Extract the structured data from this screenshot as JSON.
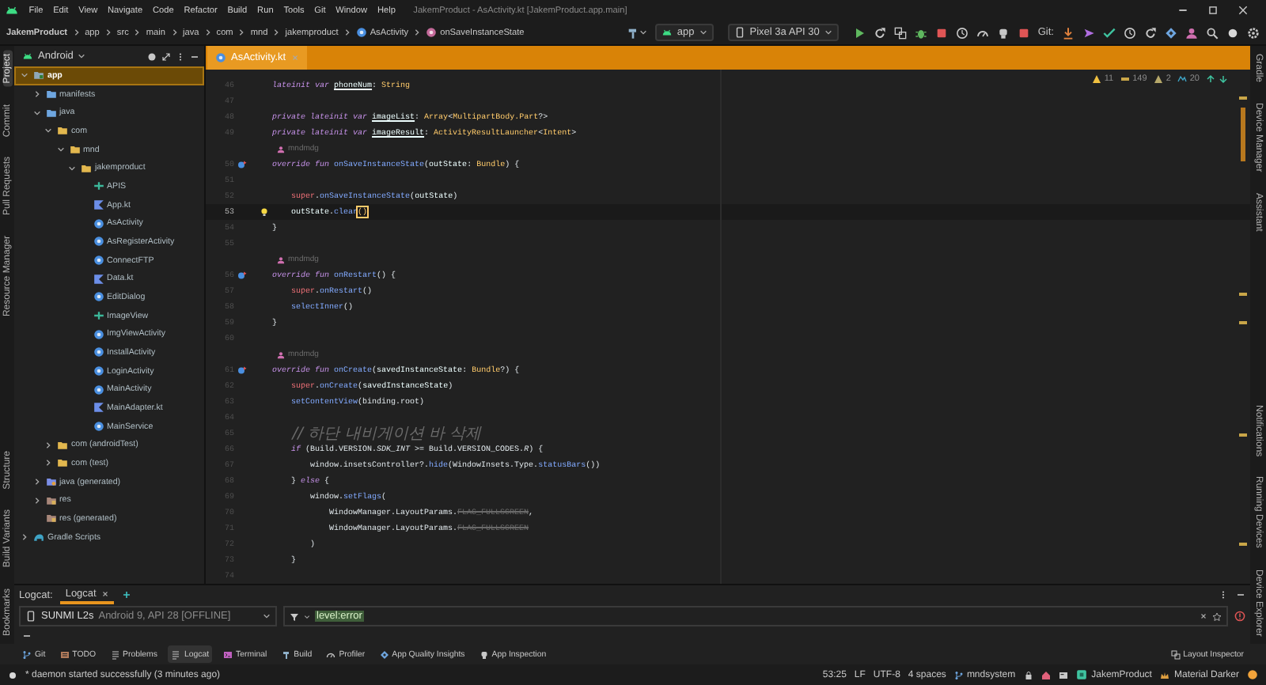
{
  "window": {
    "title": "JakemProduct - AsActivity.kt [JakemProduct.app.main]",
    "menu": [
      "File",
      "Edit",
      "View",
      "Navigate",
      "Code",
      "Refactor",
      "Build",
      "Run",
      "Tools",
      "Git",
      "Window",
      "Help"
    ]
  },
  "breadcrumbs": [
    {
      "label": "JakemProduct",
      "kind": "project"
    },
    {
      "label": "app",
      "kind": "folder"
    },
    {
      "label": "src",
      "kind": "folder"
    },
    {
      "label": "main",
      "kind": "folder"
    },
    {
      "label": "java",
      "kind": "folder"
    },
    {
      "label": "com",
      "kind": "folder"
    },
    {
      "label": "mnd",
      "kind": "folder"
    },
    {
      "label": "jakemproduct",
      "kind": "folder"
    },
    {
      "label": "AsActivity",
      "kind": "class"
    },
    {
      "label": "onSaveInstanceState",
      "kind": "method"
    }
  ],
  "run_toolbar": {
    "configuration": "app",
    "device": "Pixel 3a API 30",
    "git_label": "Git:"
  },
  "left_stripe": {
    "top": [
      {
        "label": "Project",
        "selected": true
      },
      {
        "label": "Commit",
        "selected": false
      },
      {
        "label": "Pull Requests",
        "selected": false
      },
      {
        "label": "Resource Manager",
        "selected": false
      }
    ],
    "bottom": [
      {
        "label": "Structure",
        "selected": false
      },
      {
        "label": "Build Variants",
        "selected": false
      },
      {
        "label": "Bookmarks",
        "selected": false
      }
    ]
  },
  "right_stripe": {
    "top": [
      {
        "label": "Gradle"
      },
      {
        "label": "Device Manager"
      },
      {
        "label": "Assistant"
      }
    ],
    "bottom": [
      {
        "label": "Notifications"
      },
      {
        "label": "Running Devices"
      },
      {
        "label": "Device Explorer"
      }
    ]
  },
  "project_panel": {
    "view": "Android",
    "tree": [
      {
        "label": "app",
        "kind": "module",
        "expanded": true,
        "selected": true,
        "children": [
          {
            "label": "manifests",
            "kind": "source-folder",
            "expanded": false,
            "selected": false
          },
          {
            "label": "java",
            "kind": "source-folder",
            "expanded": true,
            "selected": false,
            "children": [
              {
                "label": "com",
                "kind": "package",
                "expanded": true,
                "selected": false,
                "children": [
                  {
                    "label": "mnd",
                    "kind": "package",
                    "expanded": true,
                    "selected": false,
                    "children": [
                      {
                        "label": "jakemproduct",
                        "kind": "package",
                        "expanded": true,
                        "selected": false,
                        "children": [
                          {
                            "label": "APIS",
                            "kind": "interface",
                            "selected": false
                          },
                          {
                            "label": "App.kt",
                            "kind": "kotlin-file",
                            "selected": false
                          },
                          {
                            "label": "AsActivity",
                            "kind": "class",
                            "selected": false
                          },
                          {
                            "label": "AsRegisterActivity",
                            "kind": "class",
                            "selected": false
                          },
                          {
                            "label": "ConnectFTP",
                            "kind": "class",
                            "selected": false
                          },
                          {
                            "label": "Data.kt",
                            "kind": "kotlin-file",
                            "selected": false
                          },
                          {
                            "label": "EditDialog",
                            "kind": "class",
                            "selected": false
                          },
                          {
                            "label": "ImageView",
                            "kind": "interface",
                            "selected": false
                          },
                          {
                            "label": "ImgViewActivity",
                            "kind": "class",
                            "selected": false
                          },
                          {
                            "label": "InstallActivity",
                            "kind": "class",
                            "selected": false
                          },
                          {
                            "label": "LoginActivity",
                            "kind": "class",
                            "selected": false
                          },
                          {
                            "label": "MainActivity",
                            "kind": "class",
                            "selected": false
                          },
                          {
                            "label": "MainAdapter.kt",
                            "kind": "kotlin-file",
                            "selected": false
                          },
                          {
                            "label": "MainService",
                            "kind": "class",
                            "selected": false
                          }
                        ]
                      }
                    ]
                  }
                ]
              },
              {
                "label": "com (androidTest)",
                "kind": "package",
                "expanded": false,
                "selected": false
              },
              {
                "label": "com (test)",
                "kind": "package",
                "expanded": false,
                "selected": false
              }
            ]
          },
          {
            "label": "java (generated)",
            "kind": "generated-folder",
            "expanded": false,
            "selected": false
          },
          {
            "label": "res",
            "kind": "res-folder",
            "expanded": false,
            "selected": false
          },
          {
            "label": "res (generated)",
            "kind": "res-folder",
            "selected": false
          }
        ]
      },
      {
        "label": "Gradle Scripts",
        "kind": "gradle",
        "expanded": false,
        "selected": false
      }
    ]
  },
  "editor": {
    "tabs": [
      {
        "label": "AsActivity.kt",
        "selected": true
      }
    ],
    "inspections": [
      {
        "kind": "warning",
        "count": "11"
      },
      {
        "kind": "typo",
        "count": "149"
      },
      {
        "kind": "weak-warning",
        "count": "2"
      },
      {
        "kind": "info",
        "count": "20"
      }
    ],
    "lines": [
      {
        "kind": "code",
        "number": "46",
        "current": false,
        "tokens": [
          {
            "kind": "keyword",
            "text": "lateinit var "
          },
          {
            "kind": "property",
            "text": "phoneNum"
          },
          {
            "kind": "plain",
            "text": ": "
          },
          {
            "kind": "type",
            "text": "String"
          }
        ]
      },
      {
        "kind": "code",
        "number": "47",
        "current": false
      },
      {
        "kind": "code",
        "number": "48",
        "current": false,
        "tokens": [
          {
            "kind": "keyword",
            "text": "private lateinit var "
          },
          {
            "kind": "property",
            "text": "imageList"
          },
          {
            "kind": "plain",
            "text": ": "
          },
          {
            "kind": "type",
            "text": "Array"
          },
          {
            "kind": "plain",
            "text": "<"
          },
          {
            "kind": "type",
            "text": "MultipartBody.Part"
          },
          {
            "kind": "plain",
            "text": "?>"
          }
        ]
      },
      {
        "kind": "code",
        "number": "49",
        "current": false,
        "tokens": [
          {
            "kind": "keyword",
            "text": "private lateinit var "
          },
          {
            "kind": "property",
            "text": "imageResult"
          },
          {
            "kind": "plain",
            "text": ": "
          },
          {
            "kind": "type",
            "text": "ActivityResultLauncher"
          },
          {
            "kind": "plain",
            "text": "<"
          },
          {
            "kind": "type",
            "text": "Intent"
          },
          {
            "kind": "plain",
            "text": ">"
          }
        ]
      },
      {
        "kind": "author",
        "text": "mndmdg"
      },
      {
        "kind": "code",
        "number": "50",
        "current": false,
        "gutter": {
          "kind": "override"
        },
        "tokens": [
          {
            "kind": "keyword",
            "text": "override fun "
          },
          {
            "kind": "function",
            "text": "onSaveInstanceState"
          },
          {
            "kind": "plain",
            "text": "("
          },
          {
            "kind": "param",
            "text": "outState"
          },
          {
            "kind": "plain",
            "text": ": "
          },
          {
            "kind": "type",
            "text": "Bundle"
          },
          {
            "kind": "plain",
            "text": ") {"
          }
        ]
      },
      {
        "kind": "code",
        "number": "51",
        "current": false
      },
      {
        "kind": "code",
        "number": "52",
        "current": false,
        "tokens": [
          {
            "kind": "super",
            "text": "    super"
          },
          {
            "kind": "plain",
            "text": "."
          },
          {
            "kind": "function",
            "text": "onSaveInstanceState"
          },
          {
            "kind": "plain",
            "text": "("
          },
          {
            "kind": "param",
            "text": "outState"
          },
          {
            "kind": "plain",
            "text": ")"
          }
        ]
      },
      {
        "kind": "code",
        "number": "53",
        "current": true,
        "gutter": {
          "kind": "bulb"
        },
        "tokens": [
          {
            "kind": "param",
            "text": "    outState"
          },
          {
            "kind": "plain",
            "text": "."
          },
          {
            "kind": "function",
            "text": "clear"
          },
          {
            "kind": "match",
            "text": "()"
          }
        ]
      },
      {
        "kind": "code",
        "number": "54",
        "current": false,
        "tokens": [
          {
            "kind": "plain",
            "text": "}"
          }
        ]
      },
      {
        "kind": "code",
        "number": "55",
        "current": false
      },
      {
        "kind": "author",
        "text": "mndmdg"
      },
      {
        "kind": "code",
        "number": "56",
        "current": false,
        "gutter": {
          "kind": "override"
        },
        "tokens": [
          {
            "kind": "keyword",
            "text": "override fun "
          },
          {
            "kind": "function",
            "text": "onRestart"
          },
          {
            "kind": "plain",
            "text": "() {"
          }
        ]
      },
      {
        "kind": "code",
        "number": "57",
        "current": false,
        "tokens": [
          {
            "kind": "super",
            "text": "    super"
          },
          {
            "kind": "plain",
            "text": "."
          },
          {
            "kind": "function",
            "text": "onRestart"
          },
          {
            "kind": "plain",
            "text": "()"
          }
        ]
      },
      {
        "kind": "code",
        "number": "58",
        "current": false,
        "tokens": [
          {
            "kind": "function",
            "text": "    selectInner"
          },
          {
            "kind": "plain",
            "text": "()"
          }
        ]
      },
      {
        "kind": "code",
        "number": "59",
        "current": false,
        "tokens": [
          {
            "kind": "plain",
            "text": "}"
          }
        ]
      },
      {
        "kind": "code",
        "number": "60",
        "current": false
      },
      {
        "kind": "author",
        "text": "mndmdg"
      },
      {
        "kind": "code",
        "number": "61",
        "current": false,
        "gutter": {
          "kind": "override"
        },
        "tokens": [
          {
            "kind": "keyword",
            "text": "override fun "
          },
          {
            "kind": "function",
            "text": "onCreate"
          },
          {
            "kind": "plain",
            "text": "("
          },
          {
            "kind": "param",
            "text": "savedInstanceState"
          },
          {
            "kind": "plain",
            "text": ": "
          },
          {
            "kind": "type",
            "text": "Bundle"
          },
          {
            "kind": "plain",
            "text": "?) {"
          }
        ]
      },
      {
        "kind": "code",
        "number": "62",
        "current": false,
        "tokens": [
          {
            "kind": "super",
            "text": "    super"
          },
          {
            "kind": "plain",
            "text": "."
          },
          {
            "kind": "function",
            "text": "onCreate"
          },
          {
            "kind": "plain",
            "text": "("
          },
          {
            "kind": "param",
            "text": "savedInstanceState"
          },
          {
            "kind": "plain",
            "text": ")"
          }
        ]
      },
      {
        "kind": "code",
        "number": "63",
        "current": false,
        "tokens": [
          {
            "kind": "function",
            "text": "    setContentView"
          },
          {
            "kind": "plain",
            "text": "(binding.root)"
          }
        ]
      },
      {
        "kind": "code",
        "number": "64",
        "current": false
      },
      {
        "kind": "code",
        "number": "65",
        "current": false,
        "tokens": [
          {
            "kind": "comment",
            "text": "    // 하단 내비게이션 바 삭제"
          }
        ]
      },
      {
        "kind": "code",
        "number": "66",
        "current": false,
        "tokens": [
          {
            "kind": "keyword",
            "text": "    if"
          },
          {
            "kind": "plain",
            "text": " (Build.VERSION."
          },
          {
            "kind": "constant",
            "text": "SDK_INT"
          },
          {
            "kind": "plain",
            "text": " >= Build.VERSION_CODES."
          },
          {
            "kind": "constant",
            "text": "R"
          },
          {
            "kind": "plain",
            "text": ") {"
          }
        ]
      },
      {
        "kind": "code",
        "number": "67",
        "current": false,
        "tokens": [
          {
            "kind": "plain",
            "text": "        window.insetsController?."
          },
          {
            "kind": "function",
            "text": "hide"
          },
          {
            "kind": "plain",
            "text": "(WindowInsets.Type."
          },
          {
            "kind": "function",
            "text": "statusBars"
          },
          {
            "kind": "plain",
            "text": "())"
          }
        ]
      },
      {
        "kind": "code",
        "number": "68",
        "current": false,
        "tokens": [
          {
            "kind": "plain",
            "text": "    } "
          },
          {
            "kind": "keyword",
            "text": "else"
          },
          {
            "kind": "plain",
            "text": " {"
          }
        ]
      },
      {
        "kind": "code",
        "number": "69",
        "current": false,
        "tokens": [
          {
            "kind": "plain",
            "text": "        window."
          },
          {
            "kind": "function",
            "text": "setFlags"
          },
          {
            "kind": "plain",
            "text": "("
          }
        ]
      },
      {
        "kind": "code",
        "number": "70",
        "current": false,
        "tokens": [
          {
            "kind": "plain",
            "text": "            WindowManager.LayoutParams."
          },
          {
            "kind": "deprecated",
            "text": "FLAG_FULLSCREEN"
          },
          {
            "kind": "plain",
            "text": ","
          }
        ]
      },
      {
        "kind": "code",
        "number": "71",
        "current": false,
        "tokens": [
          {
            "kind": "plain",
            "text": "            WindowManager.LayoutParams."
          },
          {
            "kind": "deprecated",
            "text": "FLAG_FULLSCREEN"
          }
        ]
      },
      {
        "kind": "code",
        "number": "72",
        "current": false,
        "tokens": [
          {
            "kind": "plain",
            "text": "        )"
          }
        ]
      },
      {
        "kind": "code",
        "number": "73",
        "current": false,
        "tokens": [
          {
            "kind": "plain",
            "text": "    }"
          }
        ]
      },
      {
        "kind": "code",
        "number": "74",
        "current": false
      }
    ]
  },
  "bottom_panel": {
    "title": "Logcat:",
    "tabs": [
      {
        "label": "Logcat",
        "selected": true
      }
    ],
    "device": {
      "name": "SUNMI L2s",
      "detail": "Android 9, API 28 [OFFLINE]"
    },
    "filter": {
      "value": "level:error"
    }
  },
  "tool_windows": {
    "left": [
      {
        "label": "Git",
        "selected": false
      },
      {
        "label": "TODO",
        "selected": false
      },
      {
        "label": "Problems",
        "selected": false
      },
      {
        "label": "Logcat",
        "selected": true
      },
      {
        "label": "Terminal",
        "selected": false
      },
      {
        "label": "Build",
        "selected": false
      },
      {
        "label": "Profiler",
        "selected": false
      },
      {
        "label": "App Quality Insights",
        "selected": false
      },
      {
        "label": "App Inspection",
        "selected": false
      }
    ],
    "right": [
      {
        "label": "Layout Inspector",
        "selected": false
      }
    ]
  },
  "status_bar": {
    "message": "* daemon started successfully (3 minutes ago)",
    "position": "53:25",
    "line_separator": "LF",
    "encoding": "UTF-8",
    "indent": "4 spaces",
    "branch": "mndsystem",
    "project": "JakemProduct",
    "theme": "Material Darker"
  }
}
